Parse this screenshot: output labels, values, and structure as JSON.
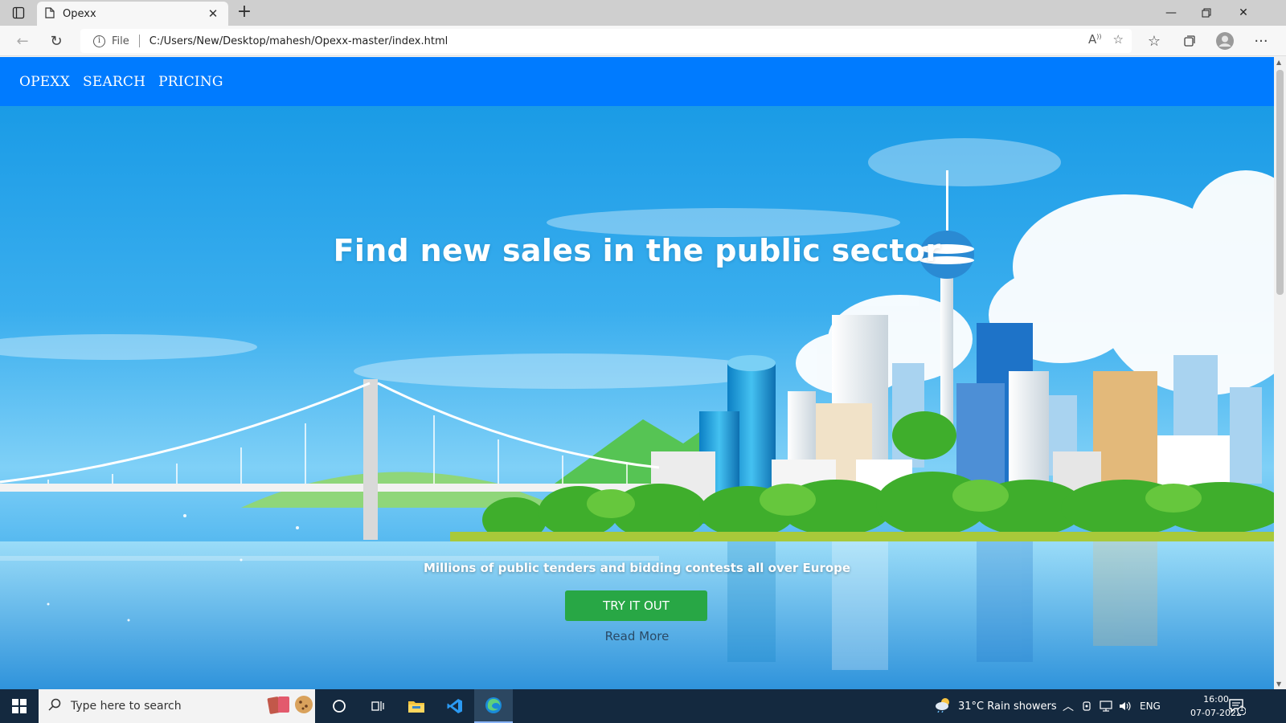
{
  "browser": {
    "tab_title": "Opexx",
    "address_scheme_label": "File",
    "url": "C:/Users/New/Desktop/mahesh/Opexx-master/index.html"
  },
  "nav": {
    "items": [
      {
        "label": "OPEXX"
      },
      {
        "label": "SEARCH"
      },
      {
        "label": "PRICING"
      }
    ]
  },
  "hero": {
    "title": "Find new sales in the public sector",
    "subtitle": "Millions of public tenders and bidding contests all over Europe",
    "cta_label": "TRY IT OUT",
    "read_more_label": "Read More"
  },
  "taskbar": {
    "search_placeholder": "Type here to search",
    "weather": "31°C  Rain showers",
    "language": "ENG",
    "time": "16:00",
    "date": "07-07-2022",
    "notification_count": "1"
  },
  "colors": {
    "navbar": "#007bff",
    "cta": "#28a745",
    "taskbar": "#14293f"
  }
}
